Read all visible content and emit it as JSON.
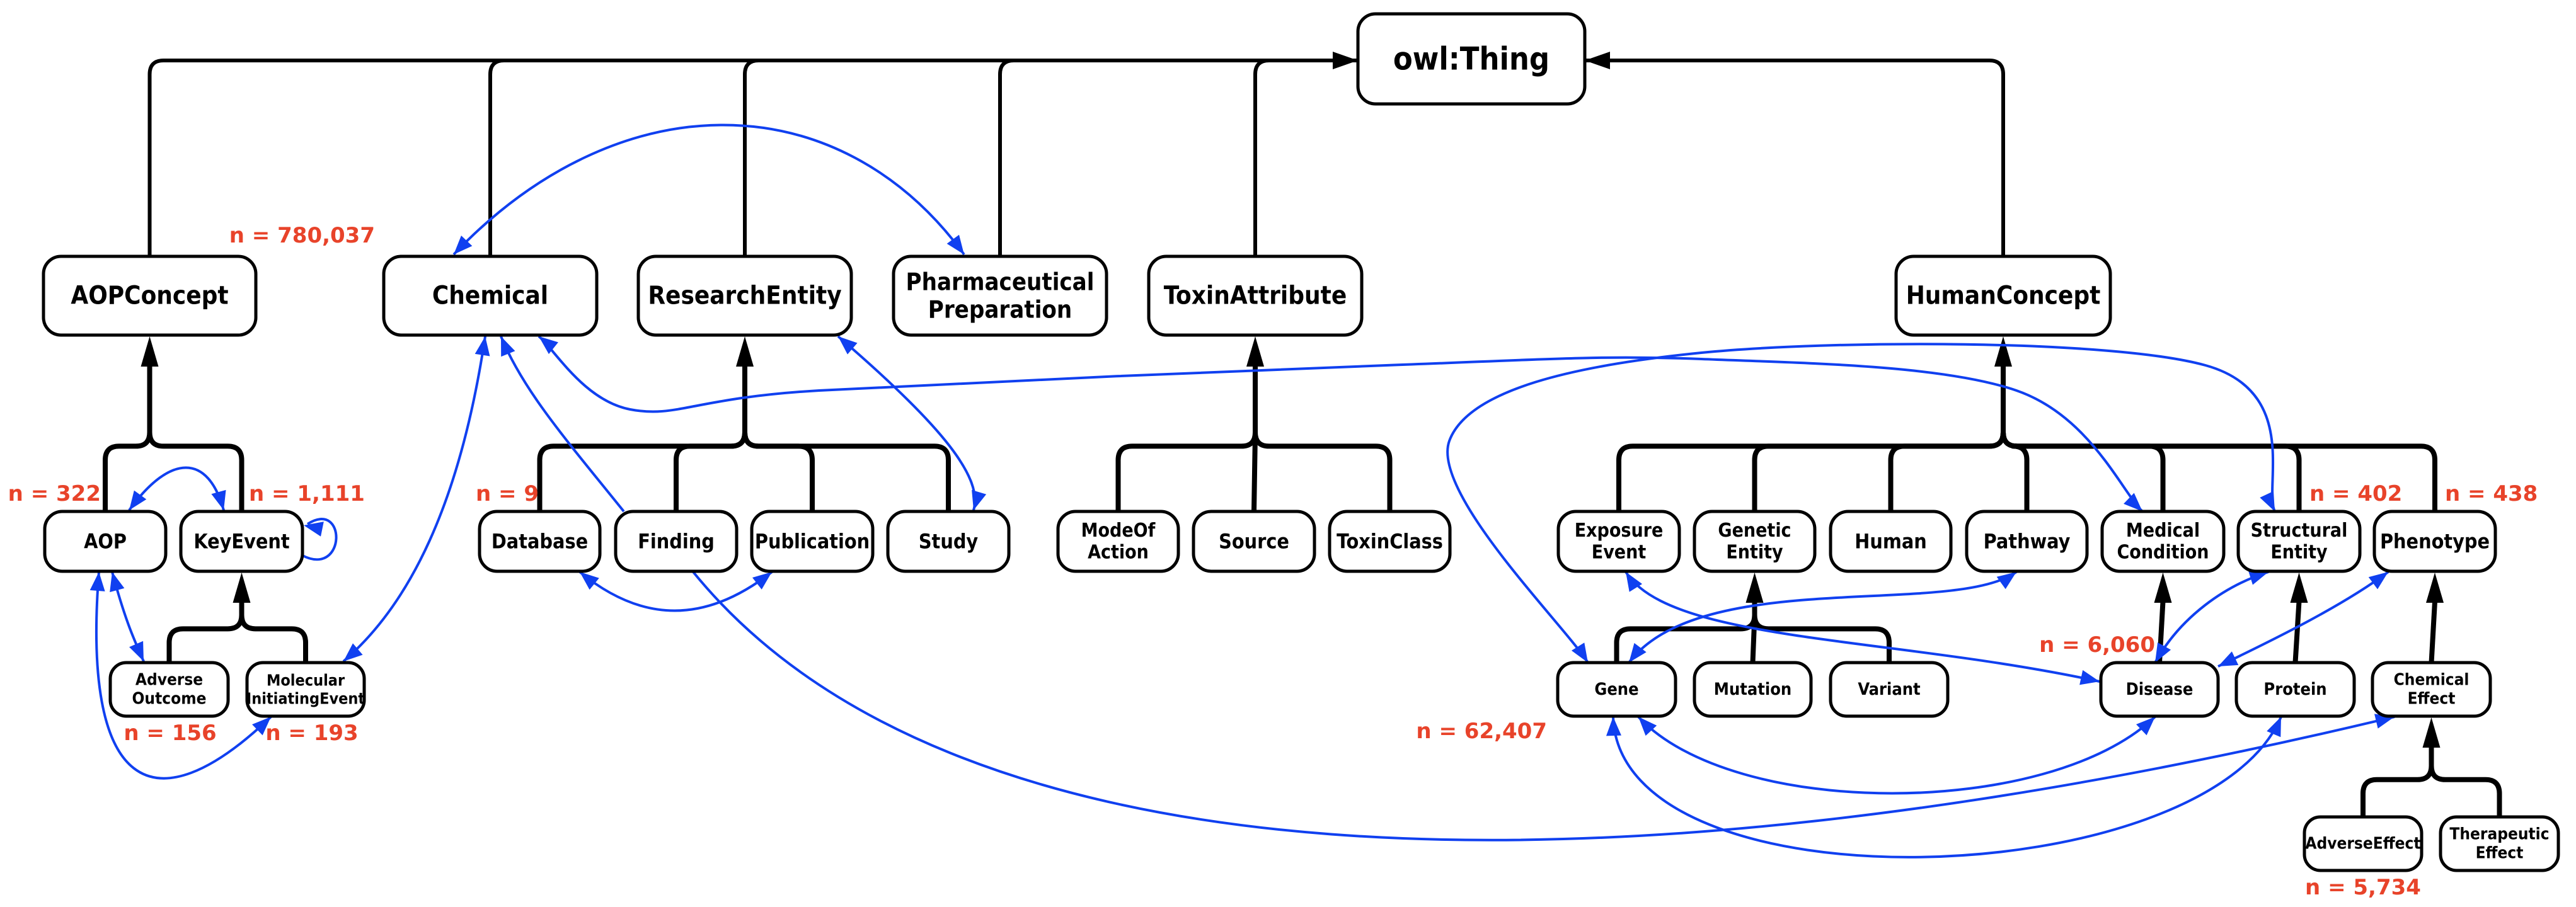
{
  "colors": {
    "subclass_edge": "#000000",
    "relation_edge": "#1040f0",
    "count_label": "#e8432a",
    "node_fill": "#ffffff",
    "node_stroke": "#000000"
  },
  "root": {
    "id": "owlThing",
    "label": "owl:Thing"
  },
  "nodes": [
    {
      "id": "owlThing",
      "label": [
        "owl:Thing"
      ],
      "parent": null
    },
    {
      "id": "AOPConcept",
      "label": [
        "AOPConcept"
      ],
      "parent": "owlThing"
    },
    {
      "id": "Chemical",
      "label": [
        "Chemical"
      ],
      "parent": "owlThing",
      "count": "n = 780,037"
    },
    {
      "id": "ResearchEntity",
      "label": [
        "ResearchEntity"
      ],
      "parent": "owlThing"
    },
    {
      "id": "PharmaceuticalPreparation",
      "label": [
        "Pharmaceutical",
        "Preparation"
      ],
      "parent": "owlThing"
    },
    {
      "id": "ToxinAttribute",
      "label": [
        "ToxinAttribute"
      ],
      "parent": "owlThing"
    },
    {
      "id": "HumanConcept",
      "label": [
        "HumanConcept"
      ],
      "parent": "owlThing"
    },
    {
      "id": "AOP",
      "label": [
        "AOP"
      ],
      "parent": "AOPConcept",
      "count": "n = 322"
    },
    {
      "id": "KeyEvent",
      "label": [
        "KeyEvent"
      ],
      "parent": "AOPConcept",
      "count": "n = 1,111"
    },
    {
      "id": "AdverseOutcome",
      "label": [
        "Adverse",
        "Outcome"
      ],
      "parent": "KeyEvent",
      "count": "n = 156"
    },
    {
      "id": "MolecularInitiatingEvent",
      "label": [
        "Molecular",
        "InitiatingEvent"
      ],
      "parent": "KeyEvent",
      "count": "n = 193"
    },
    {
      "id": "Database",
      "label": [
        "Database"
      ],
      "parent": "ResearchEntity",
      "count": "n = 9"
    },
    {
      "id": "Finding",
      "label": [
        "Finding"
      ],
      "parent": "ResearchEntity"
    },
    {
      "id": "Publication",
      "label": [
        "Publication"
      ],
      "parent": "ResearchEntity"
    },
    {
      "id": "Study",
      "label": [
        "Study"
      ],
      "parent": "ResearchEntity"
    },
    {
      "id": "ModeOfAction",
      "label": [
        "ModeOf",
        "Action"
      ],
      "parent": "ToxinAttribute"
    },
    {
      "id": "Source",
      "label": [
        "Source"
      ],
      "parent": "ToxinAttribute"
    },
    {
      "id": "ToxinClass",
      "label": [
        "ToxinClass"
      ],
      "parent": "ToxinAttribute"
    },
    {
      "id": "ExposureEvent",
      "label": [
        "Exposure",
        "Event"
      ],
      "parent": "HumanConcept"
    },
    {
      "id": "GeneticEntity",
      "label": [
        "Genetic",
        "Entity"
      ],
      "parent": "HumanConcept"
    },
    {
      "id": "Human",
      "label": [
        "Human"
      ],
      "parent": "HumanConcept"
    },
    {
      "id": "Pathway",
      "label": [
        "Pathway"
      ],
      "parent": "HumanConcept"
    },
    {
      "id": "MedicalCondition",
      "label": [
        "Medical",
        "Condition"
      ],
      "parent": "HumanConcept"
    },
    {
      "id": "StructuralEntity",
      "label": [
        "Structural",
        "Entity"
      ],
      "parent": "HumanConcept",
      "count": "n = 402"
    },
    {
      "id": "Phenotype",
      "label": [
        "Phenotype"
      ],
      "parent": "HumanConcept",
      "count": "n = 438"
    },
    {
      "id": "Gene",
      "label": [
        "Gene"
      ],
      "parent": "GeneticEntity",
      "count": "n = 62,407"
    },
    {
      "id": "Mutation",
      "label": [
        "Mutation"
      ],
      "parent": "GeneticEntity"
    },
    {
      "id": "Variant",
      "label": [
        "Variant"
      ],
      "parent": "GeneticEntity"
    },
    {
      "id": "Disease",
      "label": [
        "Disease"
      ],
      "parent": "MedicalCondition",
      "count": "n = 6,060"
    },
    {
      "id": "Protein",
      "label": [
        "Protein"
      ],
      "parent": "StructuralEntity"
    },
    {
      "id": "ChemicalEffect",
      "label": [
        "Chemical",
        "Effect"
      ],
      "parent": "Phenotype"
    },
    {
      "id": "AdverseEffect",
      "label": [
        "AdverseEffect"
      ],
      "parent": "ChemicalEffect",
      "count": "n = 5,734"
    },
    {
      "id": "TherapeuticEffect",
      "label": [
        "Therapeutic",
        "Effect"
      ],
      "parent": "ChemicalEffect"
    }
  ],
  "relations": [
    {
      "from": "Chemical",
      "to": "PharmaceuticalPreparation",
      "bidirectional": true
    },
    {
      "from": "AOP",
      "to": "KeyEvent",
      "bidirectional": true
    },
    {
      "from": "KeyEvent",
      "to": "KeyEvent",
      "bidirectional": false
    },
    {
      "from": "AOP",
      "to": "AdverseOutcome",
      "bidirectional": true
    },
    {
      "from": "AOP",
      "to": "MolecularInitiatingEvent",
      "bidirectional": true
    },
    {
      "from": "Chemical",
      "to": "MolecularInitiatingEvent",
      "bidirectional": true
    },
    {
      "from": "Finding",
      "to": "Chemical",
      "bidirectional": false
    },
    {
      "from": "Chemical",
      "to": "MedicalCondition",
      "bidirectional": true
    },
    {
      "from": "ResearchEntity",
      "to": "Study",
      "bidirectional": true
    },
    {
      "from": "Database",
      "to": "Publication",
      "bidirectional": true
    },
    {
      "from": "Finding",
      "to": "ChemicalEffect",
      "bidirectional": false
    },
    {
      "from": "Gene",
      "to": "StructuralEntity",
      "bidirectional": true
    },
    {
      "from": "ExposureEvent",
      "to": "Disease",
      "bidirectional": true
    },
    {
      "from": "Gene",
      "to": "Pathway",
      "bidirectional": true
    },
    {
      "from": "Disease",
      "to": "StructuralEntity",
      "bidirectional": true
    },
    {
      "from": "Disease",
      "to": "Phenotype",
      "bidirectional": true
    },
    {
      "from": "Gene",
      "to": "Disease",
      "bidirectional": true
    },
    {
      "from": "Gene",
      "to": "Protein",
      "bidirectional": true
    }
  ]
}
